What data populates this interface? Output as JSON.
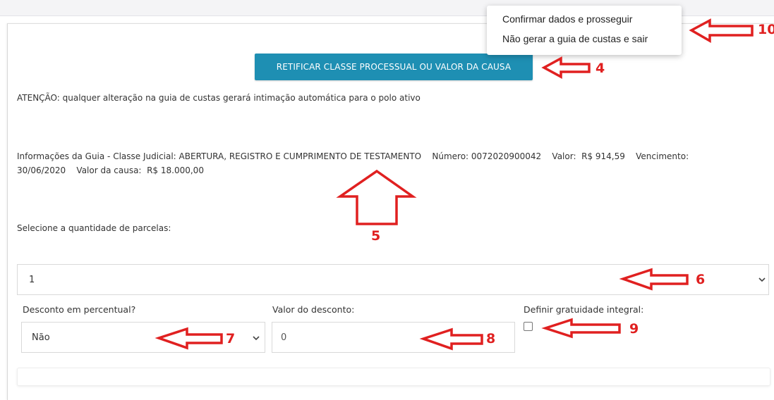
{
  "dropdown_menu": {
    "items": [
      "Confirmar dados e prosseguir",
      "Não gerar a guia de custas e sair"
    ]
  },
  "buttons": {
    "retificar_label": "RETIFICAR CLASSE PROCESSUAL OU VALOR DA CAUSA"
  },
  "texts": {
    "atencao": "ATENÇÃO: qualquer alteração na guia de custas gerará intimação automática para o polo ativo",
    "info_line1": "Informações da Guia - Classe Judicial: ABERTURA, REGISTRO E CUMPRIMENTO DE TESTAMENTO    Número: 0072020900042    Valor:  R$ 914,59    Vencimento:",
    "info_line2": "30/06/2020    Valor da causa:  R$ 18.000,00",
    "selecione_parcelas": "Selecione a quantidade de parcelas:"
  },
  "form": {
    "parcelas_value": "1",
    "desconto_percentual_label": "Desconto em percentual?",
    "desconto_percentual_value": "Não",
    "valor_desconto_label": "Valor do desconto:",
    "valor_desconto_value": "0",
    "gratuidade_label": "Definir gratuidade integral:",
    "gratuidade_checked": false
  },
  "annotations": {
    "color": "#e02020",
    "labels": [
      "10",
      "4",
      "5",
      "6",
      "7",
      "8",
      "9"
    ]
  },
  "colors": {
    "primary_button": "#1e8fb3"
  }
}
